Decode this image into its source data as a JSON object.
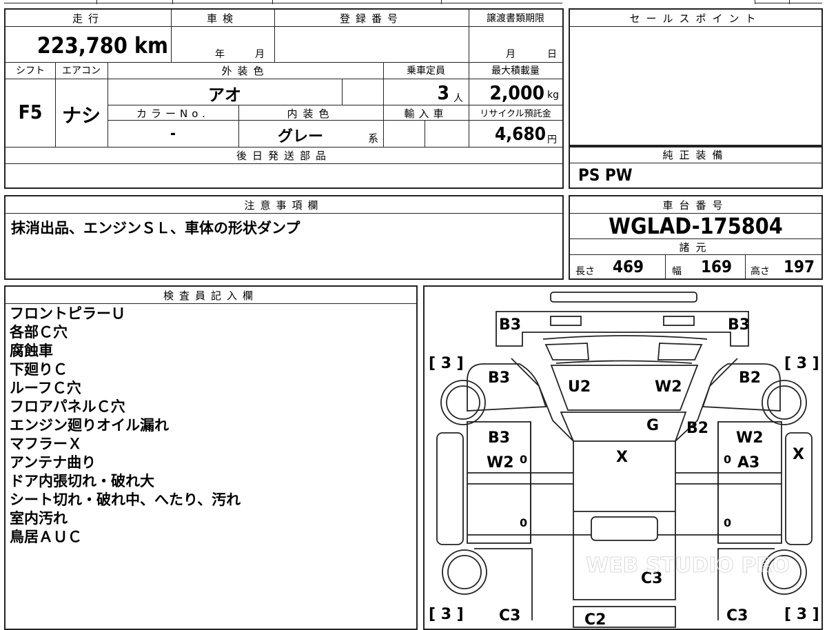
{
  "mileage": {
    "label": "走行",
    "value": "223,780",
    "unit": "km"
  },
  "inspection": {
    "label": "車検",
    "year_unit": "年",
    "month_unit": "月"
  },
  "registration": {
    "label": "登録番号"
  },
  "transfer_deadline": {
    "label": "譲渡書類期限",
    "month_unit": "月",
    "day_unit": "日"
  },
  "sale_points": {
    "label": "セールスポイント"
  },
  "shift": {
    "label": "シフト",
    "value": "F5"
  },
  "aircon": {
    "label": "エアコン",
    "value": "ナシ"
  },
  "exterior_color": {
    "label": "外装色",
    "value": "アオ"
  },
  "capacity": {
    "label": "乗車定員",
    "value": "3",
    "unit": "人"
  },
  "max_load": {
    "label": "最大積載量",
    "value": "2,000",
    "unit": "kg"
  },
  "color_no": {
    "label": "カラーNo.",
    "value": "-"
  },
  "interior_color": {
    "label": "内装色",
    "value": "グレー",
    "suffix": "系"
  },
  "import": {
    "label": "輸入車"
  },
  "recycle": {
    "label": "リサイクル預託金",
    "value": "4,680",
    "unit": "円"
  },
  "later_parts": {
    "label": "後日発送部品"
  },
  "equipment": {
    "label": "純正装備",
    "value": "PS PW"
  },
  "notes": {
    "label": "注意事項欄",
    "value": "抹消出品、エンジンＳＬ、車体の形状ダンプ"
  },
  "chassis": {
    "label": "車台番号",
    "value": "WGLAD-175804"
  },
  "specs": {
    "label": "諸元",
    "length_label": "長さ",
    "length": "469",
    "width_label": "幅",
    "width": "169",
    "height_label": "高さ",
    "height": "197"
  },
  "inspector": {
    "label": "検査員記入欄",
    "items": [
      "フロントピラーＵ",
      "各部Ｃ穴",
      "腐蝕車",
      "下廻りＣ",
      "ルーフＣ穴",
      "フロアパネルＣ穴",
      "エンジン廻りオイル漏れ",
      "マフラーＸ",
      "アンテナ曲り",
      "ドア内張切れ・破れ大",
      "シート切れ・破れ中、へたり、汚れ",
      "室内汚れ",
      "鳥居ＡＵＣ"
    ]
  },
  "diagram": {
    "marks": {
      "b3_top_left": "B3",
      "b3_top_right": "B3",
      "b3_left": "B3",
      "b2_right": "B2",
      "u2": "U2",
      "w2_windshield": "W2",
      "g": "G",
      "b2_pillar": "B2",
      "b3_door_left": "B3",
      "w2_door_left": "W2",
      "w2_door_right": "W2",
      "a3_door_right": "A3",
      "x_roof": "X",
      "x_right": "X",
      "c3_bed": "C3",
      "c3_bottom_left": "C3",
      "c2_bottom": "C2",
      "c3_bottom_right": "C3"
    },
    "tire_front_left": "[ 3 ]",
    "tire_front_right": "[ 3 ]",
    "tire_rear_left": "[ 3 ]",
    "tire_rear_right": "[ 3 ]",
    "zero_marks": [
      "0",
      "0",
      "0",
      "0"
    ],
    "watermark": "WEB STUDIO PRO"
  }
}
